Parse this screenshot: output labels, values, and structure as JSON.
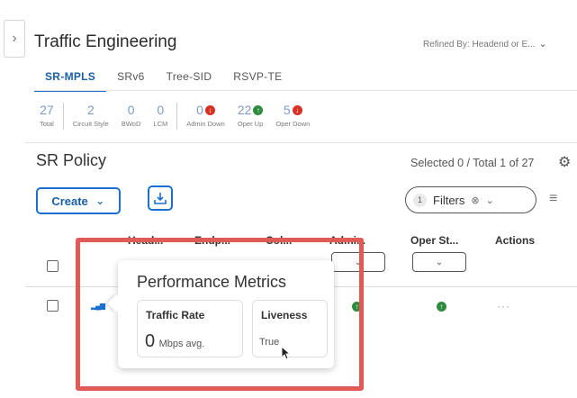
{
  "header": {
    "title": "Traffic Engineering",
    "refined": "Refined By: Headend or E..."
  },
  "tabs": [
    {
      "label": "SR-MPLS",
      "active": true
    },
    {
      "label": "SRv6",
      "active": false
    },
    {
      "label": "Tree-SID",
      "active": false
    },
    {
      "label": "RSVP-TE",
      "active": false
    }
  ],
  "stats": [
    {
      "value": "27",
      "label": "Total"
    },
    {
      "value": "2",
      "label": "Circuit Style"
    },
    {
      "value": "0",
      "label": "BWoD"
    },
    {
      "value": "0",
      "label": "LCM"
    },
    {
      "value": "0",
      "label": "Admin Down",
      "status": "down"
    },
    {
      "value": "22",
      "label": "Oper Up",
      "status": "up"
    },
    {
      "value": "5",
      "label": "Oper Down",
      "status": "down"
    }
  ],
  "section": {
    "title": "SR Policy",
    "selected": "Selected 0 / Total 1 of 27"
  },
  "toolbar": {
    "create_label": "Create",
    "filters_count": "1",
    "filters_label": "Filters"
  },
  "table": {
    "columns": [
      "Head...",
      "Endp...",
      "Col...",
      "Admi...",
      "Oper St...",
      "Actions"
    ],
    "row_actions": "···"
  },
  "popover": {
    "title": "Performance Metrics",
    "traffic_label": "Traffic Rate",
    "traffic_value": "0",
    "traffic_unit": "Mbps avg.",
    "liveness_label": "Liveness",
    "liveness_value": "True"
  },
  "colors": {
    "accent": "#1a6fd1",
    "status_up": "#2e8b3d",
    "status_down": "#d93025",
    "highlight": "#e05a56"
  }
}
